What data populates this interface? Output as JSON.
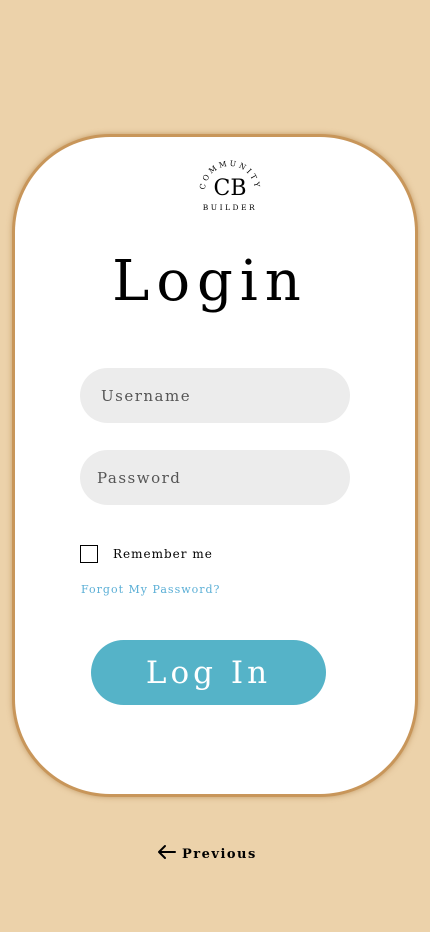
{
  "logo": {
    "initials": "CB",
    "top_text": "COMMUNITY",
    "bottom_text": "BUILDER"
  },
  "login": {
    "title": "Login",
    "username_placeholder": "Username",
    "password_placeholder": "Password",
    "remember_label": "Remember me",
    "forgot_label": "Forgot My Password?",
    "submit_label": "Log In"
  },
  "nav": {
    "previous_label": "Previous"
  },
  "colors": {
    "background": "#ecd2aa",
    "card_border": "#c8965a",
    "accent_button": "#55b3c8",
    "link": "#5bafd6",
    "field_bg": "#ececec"
  }
}
